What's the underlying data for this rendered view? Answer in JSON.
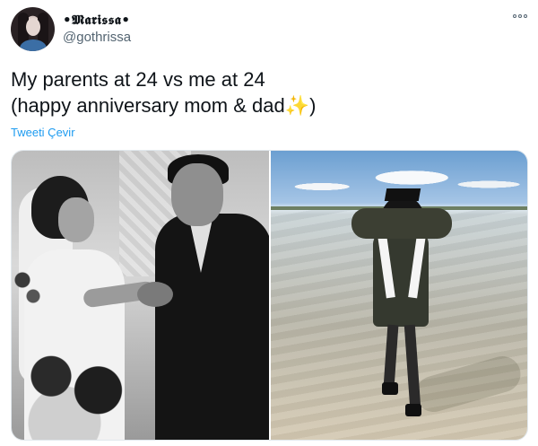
{
  "author": {
    "display_name": "•𝕸𝖆𝖗𝖎𝖘𝖘𝖆•",
    "handle": "@gothrissa",
    "avatar_icon": "profile-photo"
  },
  "tweet": {
    "line1": "My parents at 24  vs me at 24",
    "line2": "(happy anniversary mom & dad",
    "emoji": "✨",
    "line2_end": ")"
  },
  "translate_label": "Tweeti Çevir",
  "menu_icon": "more-options-icon",
  "colors": {
    "link": "#1d9bf0",
    "secondary_text": "#536471",
    "primary_text": "#0f1419"
  }
}
